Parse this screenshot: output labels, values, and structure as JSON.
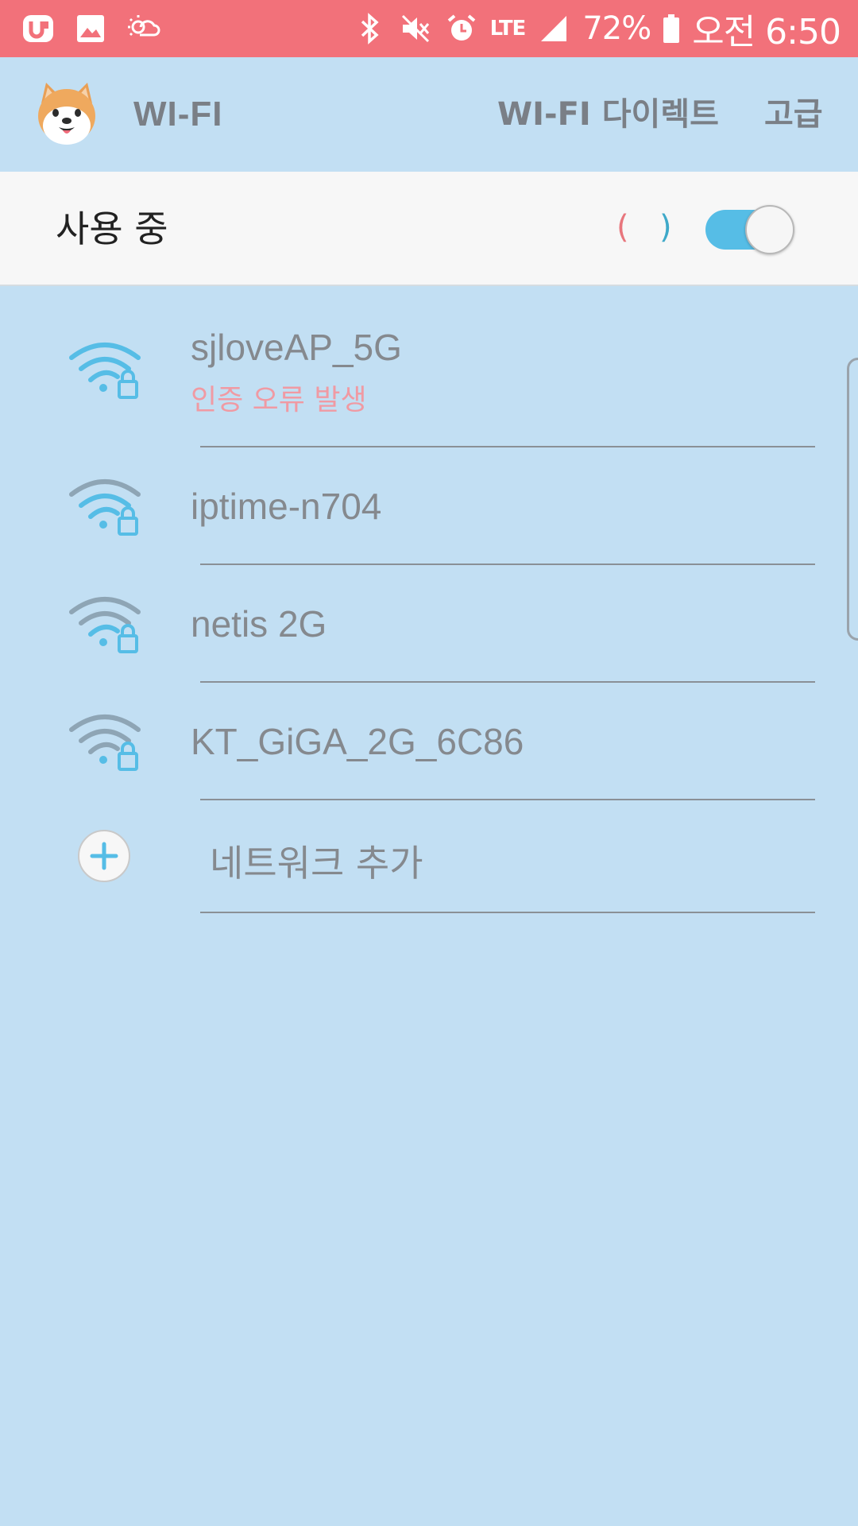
{
  "status_bar": {
    "battery_percent": "72%",
    "time": "오전 6:50",
    "network_type": "LTE",
    "left_icons": [
      "notification-app-icon",
      "gallery-icon",
      "weather-icon"
    ],
    "right_icons": [
      "bluetooth-icon",
      "mute-icon",
      "alarm-icon",
      "lte-icon",
      "signal-icon",
      "battery-icon"
    ]
  },
  "app_bar": {
    "title": "WI-FI",
    "wifi_direct_label": "WI-FI 다이렉트",
    "advanced_label": "고급"
  },
  "master_switch": {
    "label": "사용 중",
    "paren_left": "(",
    "paren_right": ")",
    "enabled": true
  },
  "networks": [
    {
      "ssid": "sjloveAP_5G",
      "status": "인증 오류 발생",
      "secured": true
    },
    {
      "ssid": "iptime-n704",
      "status": "",
      "secured": true
    },
    {
      "ssid": "netis 2G",
      "status": "",
      "secured": true
    },
    {
      "ssid": "KT_GiGA_2G_6C86",
      "status": "",
      "secured": true
    }
  ],
  "add_network": {
    "label": "네트워크 추가"
  },
  "colors": {
    "status_bar": "#f2717a",
    "background": "#c2dff3",
    "accent": "#56bde6",
    "error_text": "#f09aa3"
  }
}
